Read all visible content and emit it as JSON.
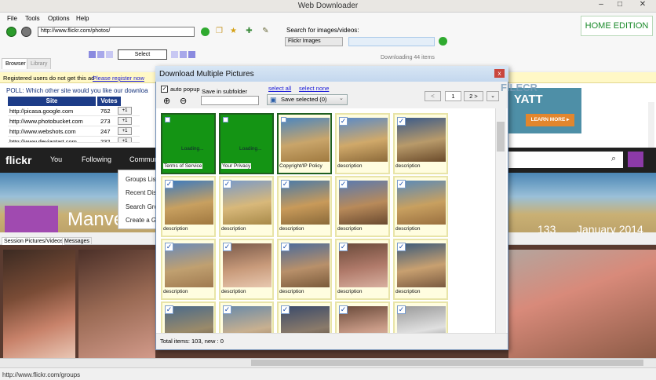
{
  "window": {
    "title": "Web Downloader",
    "controls": [
      "–",
      "□",
      "✕"
    ]
  },
  "menu": [
    "File",
    "Tools",
    "Options",
    "Help"
  ],
  "toolbar": {
    "url": "http://www.flickr.com/photos/",
    "search_label": "Search for images/videos:",
    "search_source": "Flickr Images",
    "select_label": "Select",
    "download_status": "Downloading 44 items",
    "edition": "HOME EDITION"
  },
  "tabs": [
    "Browser",
    "Library"
  ],
  "register_bar": {
    "text": "Registered users do not get this ad",
    "link": "Please register now"
  },
  "poll": {
    "question": "POLL: Which other site would you like our downloa",
    "headers": [
      "Site",
      "Votes"
    ],
    "rows": [
      {
        "site": "http://picasa.google.com",
        "votes": "762",
        "btn": "+1"
      },
      {
        "site": "http://www.photobucket.com",
        "votes": "273",
        "btn": "+1"
      },
      {
        "site": "http://www.webshots.com",
        "votes": "247",
        "btn": "+1"
      },
      {
        "site": "http://www.deviantart.com",
        "votes": "232",
        "btn": "+1"
      }
    ]
  },
  "ad": {
    "text": "YATT",
    "button": "LEARN MORE ▸"
  },
  "flickr": {
    "logo": "flickr",
    "nav": [
      "You",
      "Following",
      "Commun"
    ],
    "dropdown": [
      "Groups Lis",
      "Recent Dis",
      "Search Gro",
      "Create a G"
    ],
    "hero_title": "Manve",
    "hero_count": "133",
    "hero_date": "January 2014"
  },
  "session_tabs": [
    "Session Pictures/Videos",
    "Messages"
  ],
  "status": "http://www.flickr.com/groups",
  "dialog": {
    "title": "Download Multiple Pictures",
    "close": "x",
    "auto_popup": "auto popup",
    "subfolder_label": "Save in subfolder",
    "select_all": "select all",
    "select_none": "select none",
    "save_selected": "Save selected (0)",
    "page": "1",
    "next": "2 >",
    "footer": "Total items: 103, new : 0",
    "watermark": "FILECR",
    "cells": [
      {
        "label": "Terms of Service",
        "loading": "Loading...",
        "kind": "loading"
      },
      {
        "label": "Your Privacy",
        "loading": "Loading...",
        "kind": "loading"
      },
      {
        "label": "Copyright/IP Policy",
        "kind": "selected"
      },
      {
        "label": "description",
        "kind": "photo"
      },
      {
        "label": "description",
        "kind": "photo"
      },
      {
        "label": "description",
        "kind": "photo"
      },
      {
        "label": "description",
        "kind": "photo"
      },
      {
        "label": "description",
        "kind": "photo"
      },
      {
        "label": "description",
        "kind": "photo"
      },
      {
        "label": "description",
        "kind": "photo"
      },
      {
        "label": "description",
        "kind": "photo"
      },
      {
        "label": "description",
        "kind": "photo"
      },
      {
        "label": "description",
        "kind": "photo"
      },
      {
        "label": "description",
        "kind": "photo"
      },
      {
        "label": "description",
        "kind": "photo"
      },
      {
        "label": "",
        "kind": "photo"
      },
      {
        "label": "",
        "kind": "photo"
      },
      {
        "label": "",
        "kind": "photo"
      },
      {
        "label": "",
        "kind": "photo"
      },
      {
        "label": "",
        "kind": "photo"
      }
    ]
  }
}
